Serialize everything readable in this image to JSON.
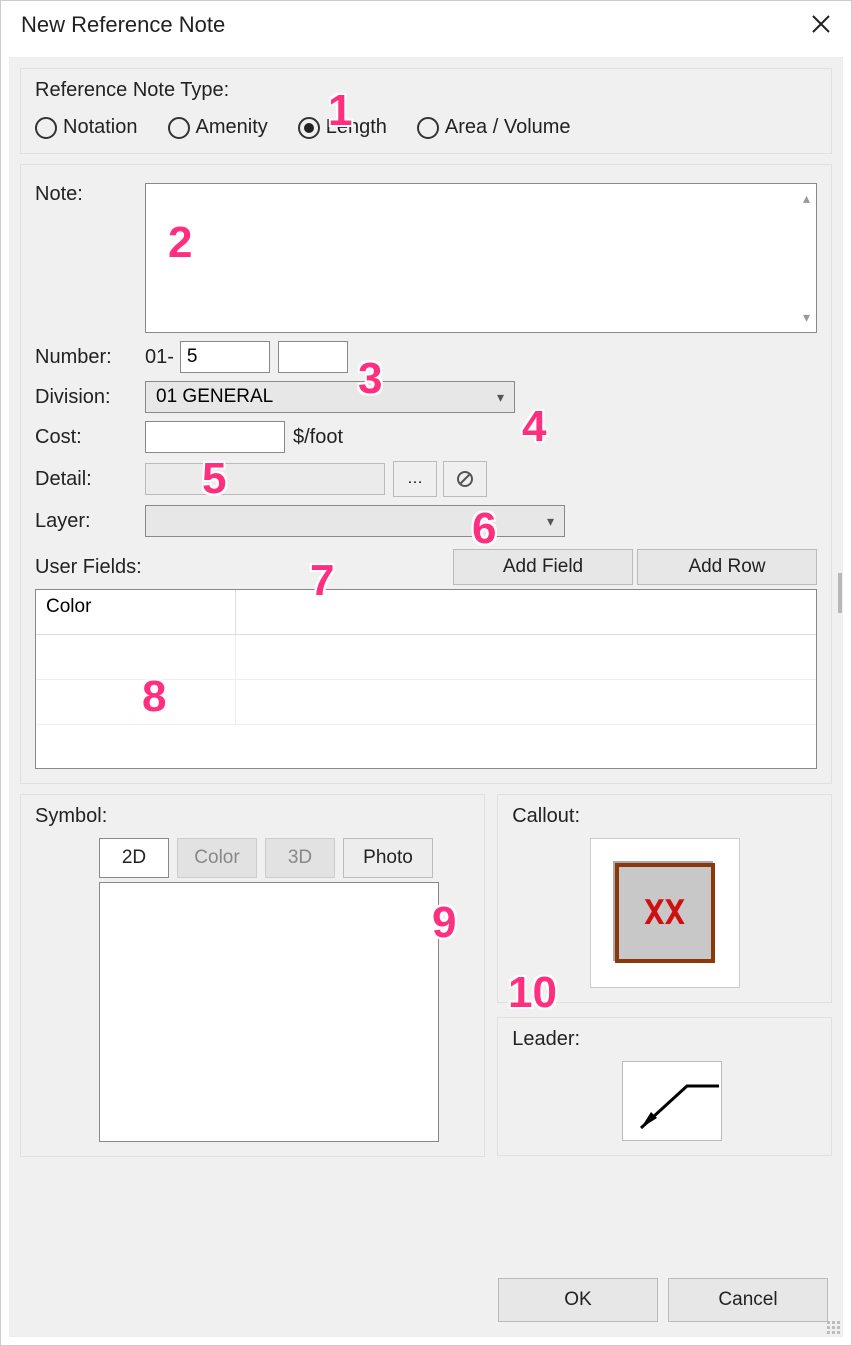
{
  "window": {
    "title": "New Reference Note"
  },
  "type_group": {
    "label": "Reference Note Type:",
    "options": {
      "notation": "Notation",
      "amenity": "Amenity",
      "length": "Length",
      "area_volume": "Area / Volume"
    },
    "selected": "length"
  },
  "fields": {
    "note_label": "Note:",
    "number_label": "Number:",
    "number_prefix": "01-",
    "number_input1": "5",
    "number_input2": "",
    "division_label": "Division:",
    "division_value": "01  GENERAL",
    "cost_label": "Cost:",
    "cost_value": "",
    "cost_unit": "$/foot",
    "detail_label": "Detail:",
    "detail_value": "",
    "layer_label": "Layer:",
    "layer_value": ""
  },
  "user_fields": {
    "label": "User Fields:",
    "add_field": "Add Field",
    "add_row": "Add Row",
    "columns": {
      "col1": "Color"
    }
  },
  "symbol": {
    "label": "Symbol:",
    "tabs": {
      "d2": "2D",
      "color": "Color",
      "d3": "3D",
      "photo": "Photo"
    }
  },
  "callout": {
    "label": "Callout:",
    "text": "XX"
  },
  "leader": {
    "label": "Leader:"
  },
  "buttons": {
    "ok": "OK",
    "cancel": "Cancel"
  },
  "annotations": {
    "a1": "1",
    "a2": "2",
    "a3": "3",
    "a4": "4",
    "a5": "5",
    "a6": "6",
    "a7": "7",
    "a8": "8",
    "a9": "9",
    "a10": "10"
  }
}
